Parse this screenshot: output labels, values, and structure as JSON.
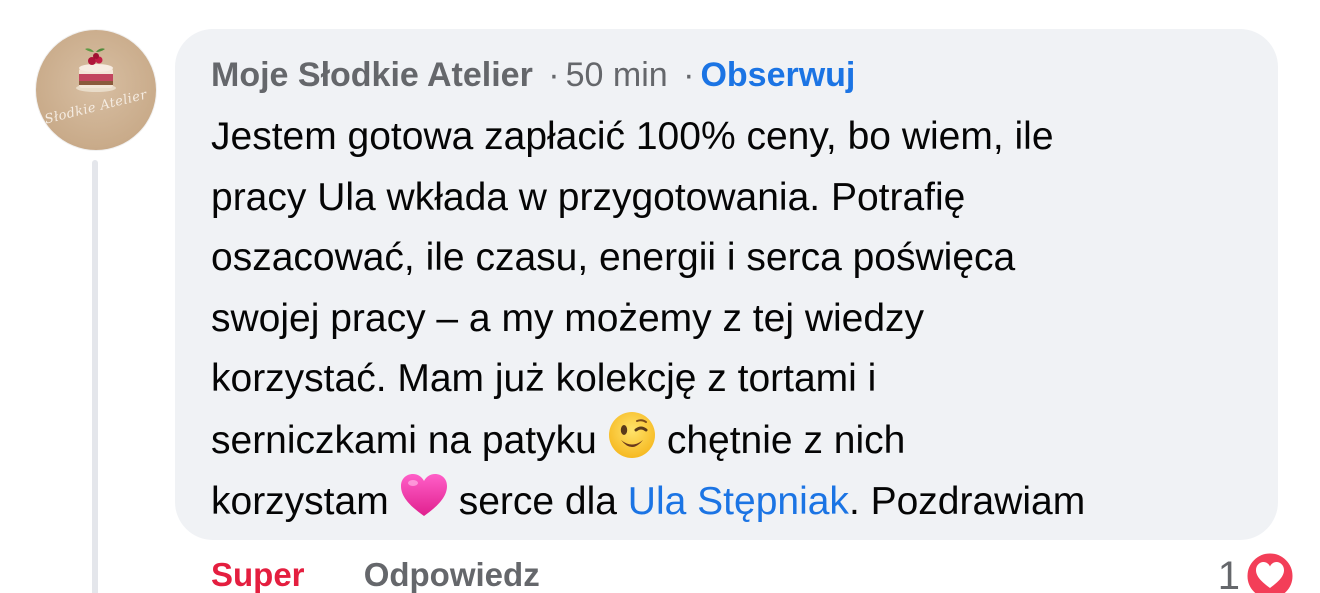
{
  "comment": {
    "author": "Moje Słodkie Atelier",
    "separator": "·",
    "time": "50 min",
    "follow_label": "Obserwuj",
    "avatar_text": "Słodkie Atelier",
    "lines": {
      "l1": "Jestem gotowa zapłacić 100% ceny, bo wiem, ile",
      "l2": "pracy Ula wkłada w przygotowania. Potrafię",
      "l3": "oszacować, ile czasu, energii i serca poświęca",
      "l4": "swojej pracy – a my możemy z tej wiedzy",
      "l5": "korzystać. Mam już kolekcję z tortami i",
      "l6a": "serniczkami na patyku",
      "l6b": "chętnie z nich",
      "l7a": "korzystam",
      "l7b": "serce dla",
      "mention": "Ula Stępniak",
      "l7c": ". Pozdrawiam"
    },
    "emojis": {
      "wink": "winking-face-emoji",
      "heart": "pink-heart-emoji"
    }
  },
  "actions": {
    "reaction_label": "Super",
    "reply_label": "Odpowiedz",
    "reaction_count": "1",
    "reaction_icon": "love-reaction-icon"
  },
  "colors": {
    "bubble": "#f0f2f5",
    "link": "#1b74e4",
    "reaction": "#e41e3f",
    "muted": "#65676b"
  }
}
